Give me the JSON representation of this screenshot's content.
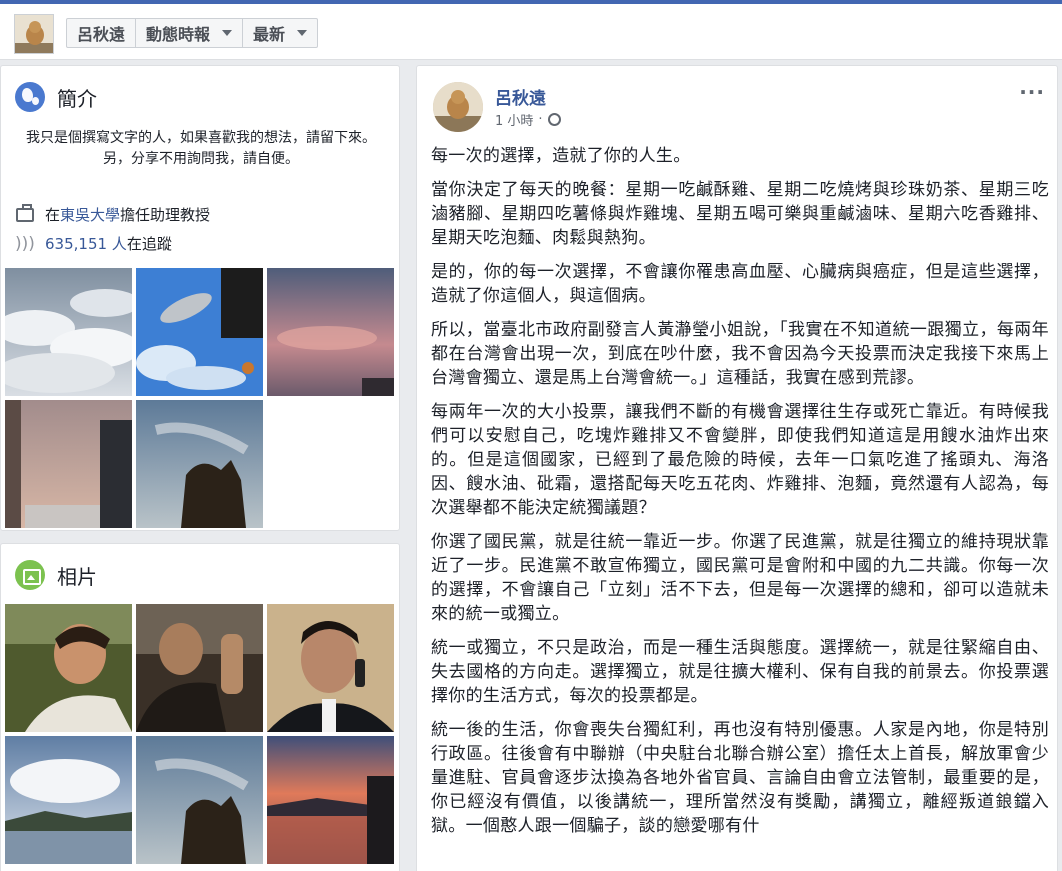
{
  "nav": {
    "profile_name": "呂秋遠",
    "timeline_label": "動態時報",
    "sort_label": "最新"
  },
  "intro": {
    "title": "簡介",
    "bio": "我只是個撰寫文字的人，如果喜歡我的想法，請留下來。另，分享不用詢問我，請自便。",
    "work_prefix": "在",
    "work_link": "東吳大學",
    "work_suffix": "擔任助理教授",
    "followers_count": "635,151 人",
    "followers_suffix": "在追蹤"
  },
  "photos": {
    "title": "相片"
  },
  "post": {
    "author": "呂秋遠",
    "time": "1 小時",
    "paragraphs": [
      "每一次的選擇，造就了你的人生。",
      "當你決定了每天的晚餐：星期一吃鹹酥雞、星期二吃燒烤與珍珠奶茶、星期三吃滷豬腳、星期四吃薯條與炸雞塊、星期五喝可樂與重鹹滷味、星期六吃香雞排、星期天吃泡麵、肉鬆與熱狗。",
      "是的，你的每一次選擇，不會讓你罹患高血壓、心臟病與癌症，但是這些選擇，造就了你這個人，與這個病。",
      "所以，當臺北市政府副發言人黃瀞瑩小姐說，「我實在不知道統一跟獨立，每兩年都在台灣會出現一次，到底在吵什麼，我不會因為今天投票而決定我接下來馬上台灣會獨立、還是馬上台灣會統一。」這種話，我實在感到荒謬。",
      "每兩年一次的大小投票，讓我們不斷的有機會選擇往生存或死亡靠近。有時候我們可以安慰自己，吃塊炸雞排又不會變胖，即使我們知道這是用餿水油炸出來的。但是這個國家，已經到了最危險的時候，去年一口氣吃進了搖頭丸、海洛因、餿水油、砒霜，還搭配每天吃五花肉、炸雞排、泡麵，竟然還有人認為，每次選舉都不能決定統獨議題？",
      "你選了國民黨，就是往統一靠近一步。你選了民進黨，就是往獨立的維持現狀靠近了一步。民進黨不敢宣佈獨立，國民黨可是會附和中國的九二共識。你每一次的選擇，不會讓自己「立刻」活不下去，但是每一次選擇的總和，卻可以造就未來的統一或獨立。",
      "統一或獨立，不只是政治，而是一種生活與態度。選擇統一，就是往緊縮自由、失去國格的方向走。選擇獨立，就是往擴大權利、保有自我的前景去。你投票選擇你的生活方式，每次的投票都是。",
      "統一後的生活，你會喪失台獨紅利，再也沒有特別優惠。人家是內地，你是特別行政區。往後會有中聯辦（中央駐台北聯合辦公室）擔任太上首長，解放軍會少量進駐、官員會逐步汰換為各地外省官員、言論自由會立法管制，最重要的是，你已經沒有價值，以後講統一，理所當然沒有獎勵，講獨立，離經叛道鋃鐺入獄。一個憨人跟一個騙子，談的戀愛哪有什"
    ]
  }
}
